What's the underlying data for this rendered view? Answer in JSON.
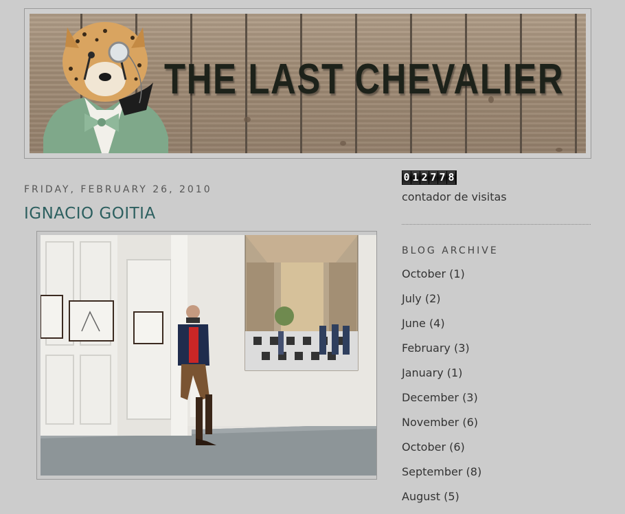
{
  "header": {
    "title": "THE LAST CHEVALIER"
  },
  "post": {
    "date": "FRIDAY, FEBRUARY 26, 2010",
    "title": "IGNACIO GOITIA"
  },
  "sidebar": {
    "counter_digits": [
      "0",
      "1",
      "2",
      "7",
      "7",
      "8"
    ],
    "counter_caption": "contador de visitas",
    "archive_title": "BLOG ARCHIVE",
    "archive": [
      {
        "month": "October",
        "count": "(1)"
      },
      {
        "month": "July",
        "count": "(2)"
      },
      {
        "month": "June",
        "count": "(4)"
      },
      {
        "month": "February",
        "count": "(3)"
      },
      {
        "month": "January",
        "count": "(1)"
      },
      {
        "month": "December",
        "count": "(3)"
      },
      {
        "month": "November",
        "count": "(6)"
      },
      {
        "month": "October",
        "count": "(6)"
      },
      {
        "month": "September",
        "count": "(8)"
      },
      {
        "month": "August",
        "count": "(5)"
      }
    ]
  },
  "colors": {
    "background": "#cccccc",
    "post_title": "#2c5f5f",
    "text": "#333333"
  },
  "icons": [
    "cheetah-mascot-logo"
  ]
}
